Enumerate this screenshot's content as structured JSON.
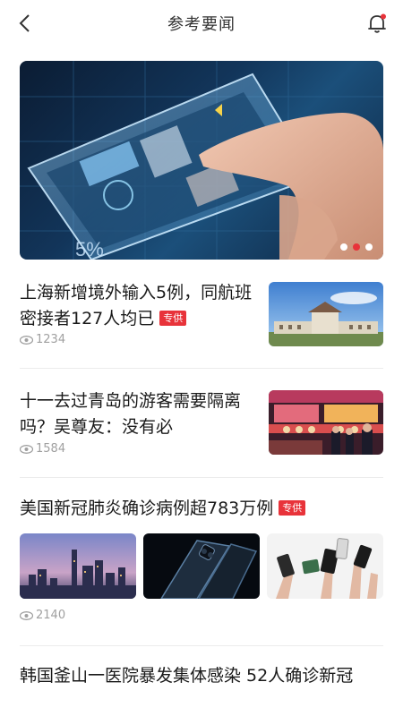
{
  "header": {
    "title": "参考要闻",
    "back_icon": "chevron-left-icon",
    "bell_icon": "bell-icon",
    "notification_dot_color": "#e8333a"
  },
  "banner": {
    "slide_count": 3,
    "active_slide": 2,
    "overlay_text": "5%"
  },
  "news": [
    {
      "headline": "上海新增境外输入5例，同航班密接者127人均已",
      "tag": "专供",
      "views": "1234"
    },
    {
      "headline": "十一去过青岛的游客需要隔离吗？吴尊友：没有必",
      "views": "1584"
    },
    {
      "headline": "美国新冠肺炎确诊病例超783万例",
      "tag": "专供",
      "views": "2140"
    },
    {
      "headline": "韩国釜山一医院暴发集体感染 52人确诊新冠"
    }
  ],
  "colors": {
    "accent": "#e8333a",
    "muted": "#a0a0a0"
  }
}
